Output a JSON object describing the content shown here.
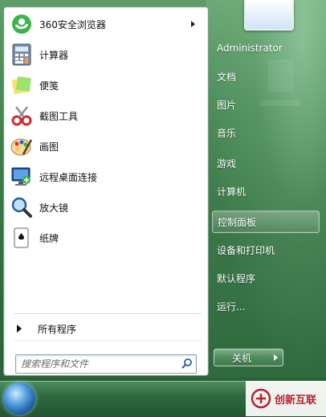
{
  "programs": [
    {
      "label": "360安全浏览器",
      "icon": "browser-360-icon",
      "has_submenu": true
    },
    {
      "label": "计算器",
      "icon": "calculator-icon"
    },
    {
      "label": "便笺",
      "icon": "sticky-notes-icon"
    },
    {
      "label": "截图工具",
      "icon": "snipping-tool-icon"
    },
    {
      "label": "画图",
      "icon": "paint-icon"
    },
    {
      "label": "远程桌面连接",
      "icon": "remote-desktop-icon"
    },
    {
      "label": "放大镜",
      "icon": "magnifier-icon"
    },
    {
      "label": "纸牌",
      "icon": "solitaire-icon"
    }
  ],
  "all_programs_label": "所有程序",
  "search": {
    "placeholder": "搜索程序和文件"
  },
  "right_items": [
    {
      "label": "Administrator"
    },
    {
      "label": "文档"
    },
    {
      "label": "图片"
    },
    {
      "label": "音乐"
    },
    {
      "label": "游戏"
    },
    {
      "label": "计算机"
    },
    {
      "label": "控制面板",
      "selected": true
    },
    {
      "label": "设备和打印机"
    },
    {
      "label": "默认程序"
    },
    {
      "label": "运行..."
    }
  ],
  "shutdown_label": "关机",
  "watermark_text": "创新互联",
  "colors": {
    "aero_green": "#3f7e4e",
    "accent_red": "#b5232e"
  }
}
